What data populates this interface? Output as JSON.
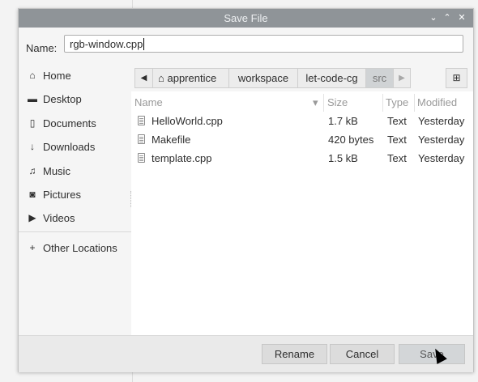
{
  "window": {
    "title": "Save File",
    "controls": [
      "⌄",
      "⌃",
      "✕"
    ]
  },
  "name_field": {
    "label": "Name:",
    "value": "rgb-window.cpp"
  },
  "sidebar": {
    "items": [
      {
        "icon": "⌂",
        "label": "Home"
      },
      {
        "icon": "▬",
        "label": "Desktop"
      },
      {
        "icon": "▯",
        "label": "Documents"
      },
      {
        "icon": "↓",
        "label": "Downloads"
      },
      {
        "icon": "♫",
        "label": "Music"
      },
      {
        "icon": "◙",
        "label": "Pictures"
      },
      {
        "icon": "▶",
        "label": "Videos"
      }
    ],
    "other": {
      "icon": "+",
      "label": "Other Locations"
    }
  },
  "pathbar": {
    "back": "◀",
    "home_icon": "⌂",
    "crumbs": [
      "apprentice",
      "workspace",
      "let-code-cg",
      "src"
    ],
    "forward": "▶",
    "new_folder_icon": "⊞"
  },
  "columns": {
    "name": "Name",
    "sort": "▾",
    "size": "Size",
    "type": "Type",
    "modified": "Modified"
  },
  "files": [
    {
      "name": "HelloWorld.cpp",
      "size": "1.7 kB",
      "type": "Text",
      "modified": "Yesterday"
    },
    {
      "name": "Makefile",
      "size": "420 bytes",
      "type": "Text",
      "modified": "Yesterday"
    },
    {
      "name": "template.cpp",
      "size": "1.5 kB",
      "type": "Text",
      "modified": "Yesterday"
    }
  ],
  "buttons": {
    "rename": "Rename",
    "cancel": "Cancel",
    "save": "Save"
  }
}
